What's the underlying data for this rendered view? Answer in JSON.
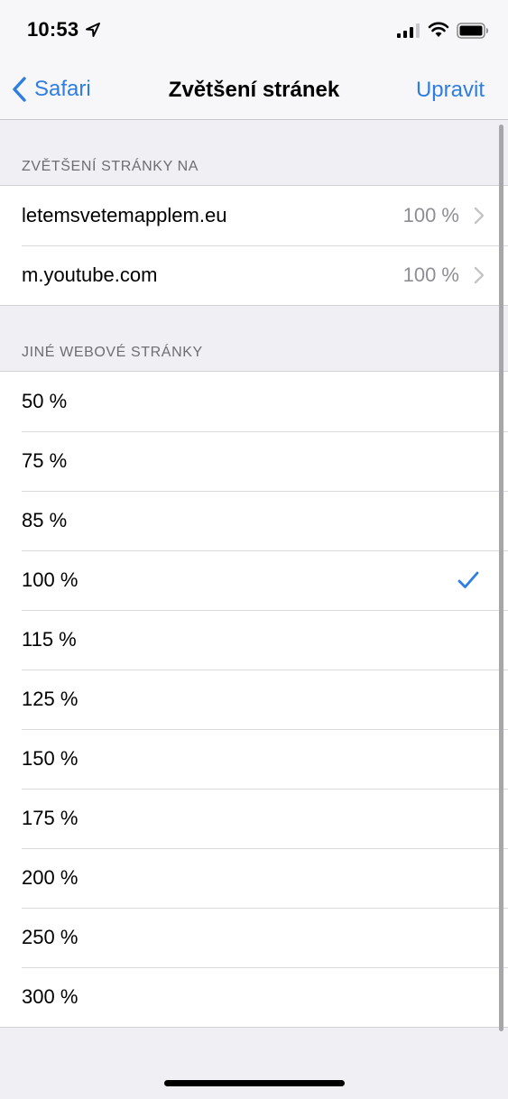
{
  "status_bar": {
    "time": "10:53"
  },
  "nav": {
    "back_label": "Safari",
    "title": "Zvětšení stránek",
    "edit_label": "Upravit"
  },
  "accent_color": "#2f7de1",
  "sites_section": {
    "header": "ZVĚTŠENÍ STRÁNKY NA",
    "items": [
      {
        "label": "letemsvetemapplem.eu",
        "value": "100 %"
      },
      {
        "label": "m.youtube.com",
        "value": "100 %"
      }
    ]
  },
  "other_section": {
    "header": "JINÉ WEBOVÉ STRÁNKY",
    "selected": "100 %",
    "options": [
      "50 %",
      "75 %",
      "85 %",
      "100 %",
      "115 %",
      "125 %",
      "150 %",
      "175 %",
      "200 %",
      "250 %",
      "300 %"
    ]
  }
}
